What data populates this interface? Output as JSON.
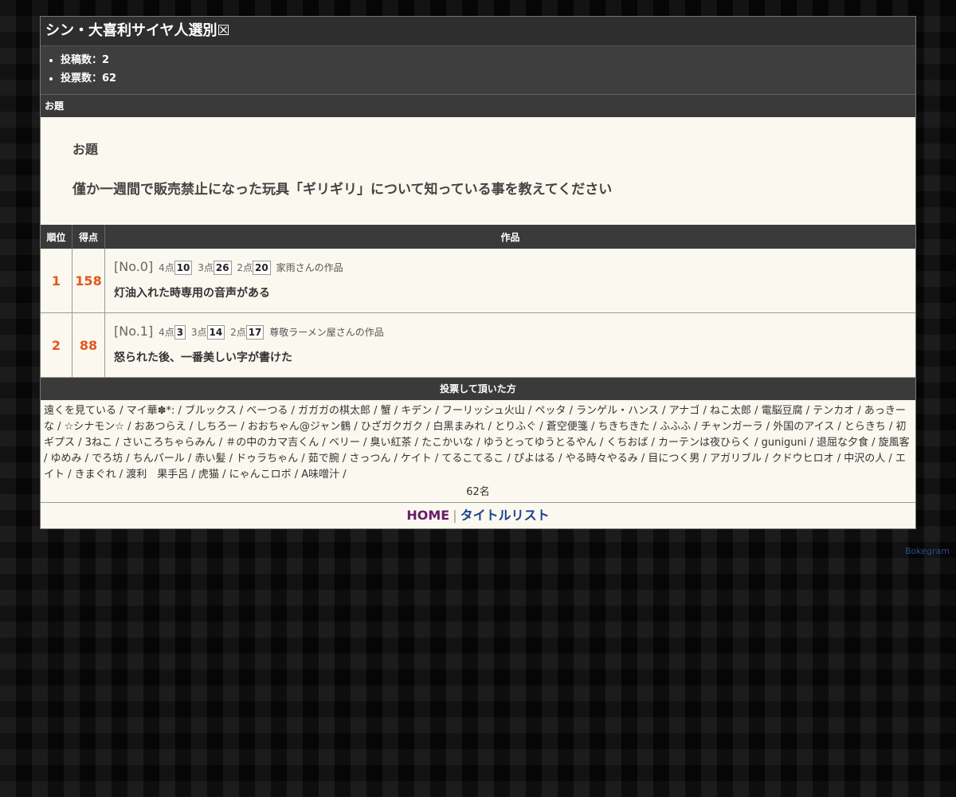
{
  "header": {
    "title": "シン・大喜利サイヤ人選別☒"
  },
  "stats": {
    "posts": "投稿数：2",
    "votes": "投票数：62"
  },
  "topic": {
    "section_label": "お題",
    "label": "お題",
    "text": "僅か一週間で販売禁止になった玩具「ギリギリ」について知っている事を教えてください"
  },
  "results": {
    "columns": [
      "順位",
      "得点",
      "作品"
    ],
    "rows": [
      {
        "rank": "1",
        "score": "158",
        "no": "[No.0]",
        "p4_label": "4点",
        "p4": "10",
        "p3_label": "3点",
        "p3": "26",
        "p2_label": "2点",
        "p2": "20",
        "author": "家雨さんの作品",
        "work": "灯油入れた時専用の音声がある"
      },
      {
        "rank": "2",
        "score": "88",
        "no": "[No.1]",
        "p4_label": "4点",
        "p4": "3",
        "p3_label": "3点",
        "p3": "14",
        "p2_label": "2点",
        "p2": "17",
        "author": "尊敬ラーメン屋さんの作品",
        "work": "怒られた後、一番美しい字が書けた"
      }
    ]
  },
  "voters": {
    "section_label": "投票して頂いた方",
    "list": "遠くを見ている / マイ華✽*: / ブルックス / べーつる / ガガガの棋太郎 / 蟹 / キデン / フーリッシュ火山 / ペッタ / ランゲル・ハンス / アナゴ / ねこ太郎 / 電脳豆腐 / テンカオ / あっきーな / ☆シナモン☆ / おあつらえ / しちろー / おおちゃん@ジャン鶴 / ひざガクガク / 白黒まみれ / とりふぐ / 蒼空便箋 / ちきちきた / ふふふ / チャンガーラ / 外国のアイス / とらきち / 初ギプス / 3ねこ / さいころちゃらみん / ＃の中のカマ吉くん / ベリー / 臭い紅茶 / たこかいな / ゆうとってゆうとるやん / くちおば / カーテンは夜ひらく / guniguni / 退屈な夕食 / 旋風客 / ゆめみ / でろ坊 / ちんパール / 赤い髪 / ドゥラちゃん / 茹で腕 / さっつん / ケイト / てるこてるこ / ぴよはる / やる時々やるみ / 目につく男 / アガリブル / クドウヒロオ / 中沢の人 / エイト / きまぐれ / 渡利　果手呂 / 虎猫 / にゃんこロボ / A味噌汁 /",
    "count": "62名"
  },
  "footer": {
    "home": "HOME",
    "separator": "|",
    "title_list": "タイトルリスト"
  },
  "credit": "Bokegram"
}
